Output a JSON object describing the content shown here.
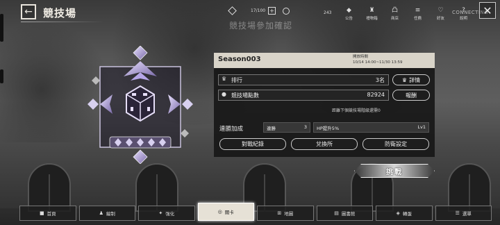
{
  "header": {
    "back_icon": "arrow-left-icon",
    "title": "競技場",
    "stamina": "17/100",
    "watermark": "競技場參加確認",
    "count": "243",
    "connecting": "CONNECTING",
    "close_icon": "close-icon"
  },
  "top_menu": [
    {
      "label": "公告",
      "icon": "◆"
    },
    {
      "label": "禮物箱",
      "icon": "♜"
    },
    {
      "label": "商店",
      "icon": "凸"
    },
    {
      "label": "任務",
      "icon": "≡"
    },
    {
      "label": "好友",
      "icon": "♡"
    },
    {
      "label": "說明",
      "icon": "?"
    }
  ],
  "season": {
    "name": "Season003",
    "period_label": "開放時間",
    "period_value": "10/14 14:00~11/30 13:59"
  },
  "rank": {
    "label": "排行",
    "value": "3名",
    "detail_button": "詳情"
  },
  "points": {
    "label": "競技場點數",
    "value": "82924",
    "reward_button": "報酬"
  },
  "next_note": "距離下個競技場階級還需0",
  "streak": {
    "label": "連勝加成",
    "type": "連勝",
    "count": "3",
    "bonus": "HP提升5%",
    "level": "Lv1"
  },
  "actions": {
    "record": "對戰紀錄",
    "exchange": "兌換所",
    "defense": "防衛設定",
    "challenge": "挑戰"
  },
  "bottom_nav": [
    {
      "label": "首頁",
      "icon": "■",
      "active": false
    },
    {
      "label": "編制",
      "icon": "♟",
      "active": false
    },
    {
      "label": "強化",
      "icon": "✦",
      "active": false
    },
    {
      "label": "關卡",
      "icon": "◎",
      "active": true
    },
    {
      "label": "地圖",
      "icon": "⊞",
      "active": false
    },
    {
      "label": "圖書館",
      "icon": "▤",
      "active": false
    },
    {
      "label": "轉蛋",
      "icon": "◈",
      "active": false
    },
    {
      "label": "選單",
      "icon": "☰",
      "active": false
    }
  ],
  "colors": {
    "panel_header": "#d9d4c9",
    "panel_bg": "#161616",
    "emblem_accent": "#b6a6e8",
    "active_nav": "#e6e1d6"
  }
}
